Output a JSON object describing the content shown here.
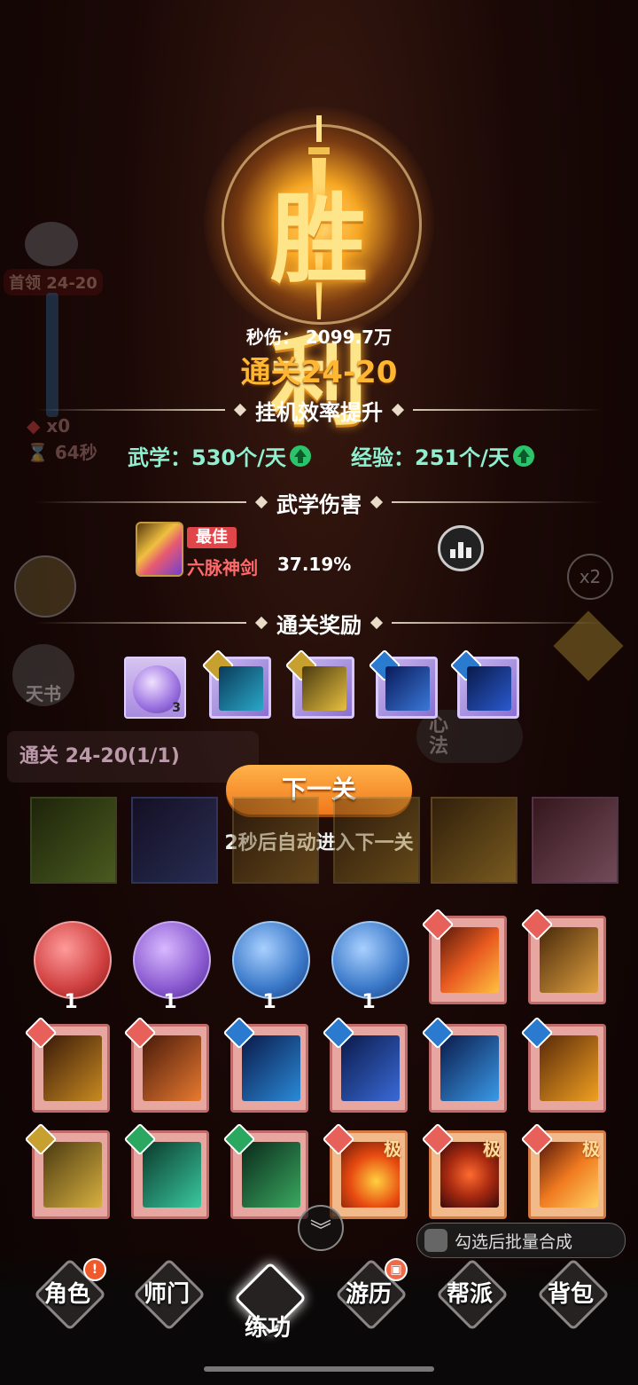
{
  "background": {
    "boss_label": "首领 24-20",
    "stat_count": "x0",
    "stat_time": "64秒",
    "left_book_label": "天书",
    "right_badge": "x2",
    "heart_label": "心法",
    "stage_progress": "通关 24-20(1/1)"
  },
  "victory": {
    "title": "胜利",
    "dps_label": "秒伤：",
    "dps_value": "2099.7万",
    "clear_stage": "通关24-20"
  },
  "efficiency": {
    "heading": "挂机效率提升",
    "martial_label": "武学：530个/天",
    "exp_label": "经验：251个/天"
  },
  "damage": {
    "heading": "武学伤害",
    "best_tag": "最佳",
    "skill_name": "六脉神剑",
    "skill_percent": "37.19%",
    "stats_icon": "bar-chart-icon"
  },
  "rewards": {
    "heading": "通关奖励",
    "items": [
      {
        "type": "orb",
        "qty": "3",
        "color": "#a88ae0"
      },
      {
        "type": "book",
        "color": "#2aa8c8"
      },
      {
        "type": "book",
        "color": "#c8a020"
      },
      {
        "type": "book",
        "color": "#3a78d8"
      },
      {
        "type": "book",
        "color": "#2a5ad0"
      }
    ]
  },
  "actions": {
    "next_label": "下一关",
    "auto_text": "2秒后自动进入下一关"
  },
  "inventory": {
    "orbs": [
      {
        "qty": "1",
        "color": "#d04040"
      },
      {
        "qty": "1",
        "color": "#8a5ad0"
      },
      {
        "qty": "1",
        "color": "#3a78c8"
      },
      {
        "qty": "1",
        "color": "#3a78c8"
      }
    ],
    "grade_label": "极",
    "batch_label": "勾选后批量合成"
  },
  "nav": {
    "items": [
      {
        "label": "角色"
      },
      {
        "label": "师门"
      },
      {
        "label": "练功"
      },
      {
        "label": "游历"
      },
      {
        "label": "帮派"
      },
      {
        "label": "背包"
      }
    ],
    "alert_badge": "!"
  }
}
